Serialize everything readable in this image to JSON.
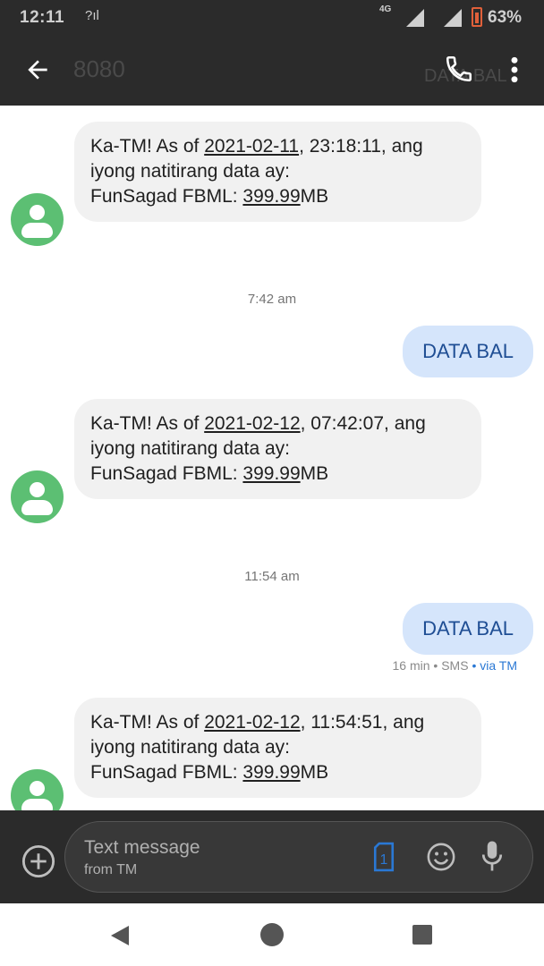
{
  "status_bar": {
    "time": "12:11",
    "network": "4G",
    "battery": "63%"
  },
  "header": {
    "contact": "8080",
    "ghost_title": "DATA BAL"
  },
  "messages": [
    {
      "prefix": "Ka-TM! As of ",
      "date": "2021-02-11",
      "time_part": ", 23:18:11, ang",
      "line2": "iyong natitirang data ay:",
      "line3_prefix": "FunSagad FBML: ",
      "amount": "399.99",
      "unit": "MB"
    },
    {
      "prefix": "Ka-TM! As of ",
      "date": "2021-02-12",
      "time_part": ", 07:42:07, ang",
      "line2": "iyong natitirang data ay:",
      "line3_prefix": "FunSagad FBML: ",
      "amount": "399.99",
      "unit": "MB"
    },
    {
      "prefix": "Ka-TM! As of ",
      "date": "2021-02-12",
      "time_part": ", 11:54:51, ang",
      "line2": "iyong natitirang data ay:",
      "line3_prefix": "FunSagad FBML: ",
      "amount": "399.99",
      "unit": "MB"
    }
  ],
  "timestamps": [
    "7:42 am",
    "11:54 am"
  ],
  "outgoing": [
    "DATA BAL",
    "DATA BAL"
  ],
  "last_meta": {
    "age": "16 min",
    "sep": " • ",
    "type": "SMS",
    "via": "via TM"
  },
  "compose": {
    "placeholder": "Text message",
    "sub": "from TM",
    "sim_number": "1"
  },
  "colors": {
    "bar_dark": "#2b2b2b",
    "avatar_green": "#5cbf73",
    "outgoing_bubble": "#d5e5fb",
    "incoming_bubble": "#f1f1f1",
    "accent_blue": "#2a78d4"
  }
}
